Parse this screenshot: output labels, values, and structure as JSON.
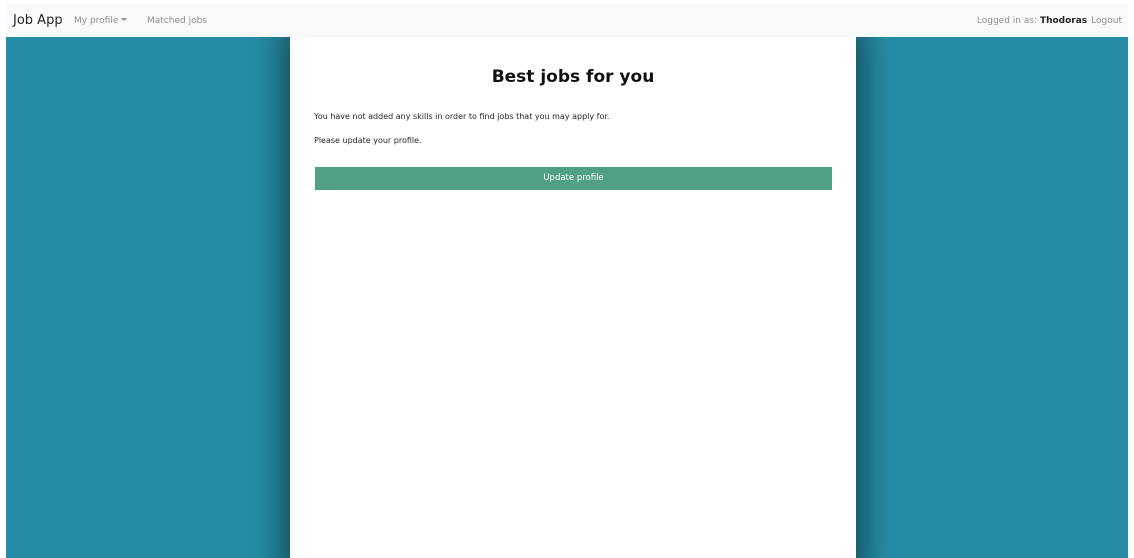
{
  "navbar": {
    "brand": "Job App",
    "my_profile": "My profile",
    "matched_jobs": "Matched jobs",
    "logged_in_prefix": "Logged in as: ",
    "username": "Thodoras",
    "logout": "Logout"
  },
  "main": {
    "title": "Best jobs for you",
    "message_1": "You have not added any skills in order to find jobs that you may apply for.",
    "message_2": "Please update your profile.",
    "update_button": "Update profile"
  },
  "colors": {
    "background": "#268ca5",
    "navbar": "#f8f9fa",
    "card": "#ffffff",
    "button": "#50a085"
  }
}
